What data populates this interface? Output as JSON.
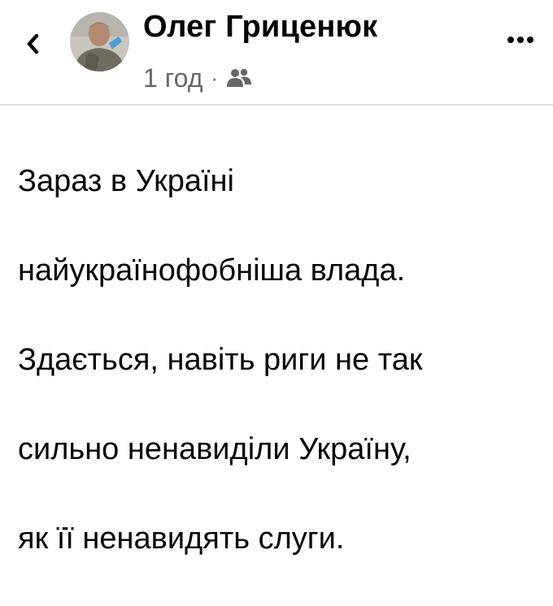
{
  "header": {
    "back_icon": "chevron-left-icon",
    "author_name": "Олег Гриценюк",
    "timestamp": "1 год",
    "separator": "·",
    "audience_icon": "friends-icon",
    "more_icon": "more-dots-icon"
  },
  "post": {
    "lines": [
      "Зараз в Україні",
      "найукраїнофобніша влада.",
      "Здається, навіть риги не так",
      "сильно ненавиділи Україну,",
      "як її ненавидять слуги."
    ]
  },
  "colors": {
    "text": "#050505",
    "secondary": "#65676b",
    "divider": "#dadde1"
  }
}
